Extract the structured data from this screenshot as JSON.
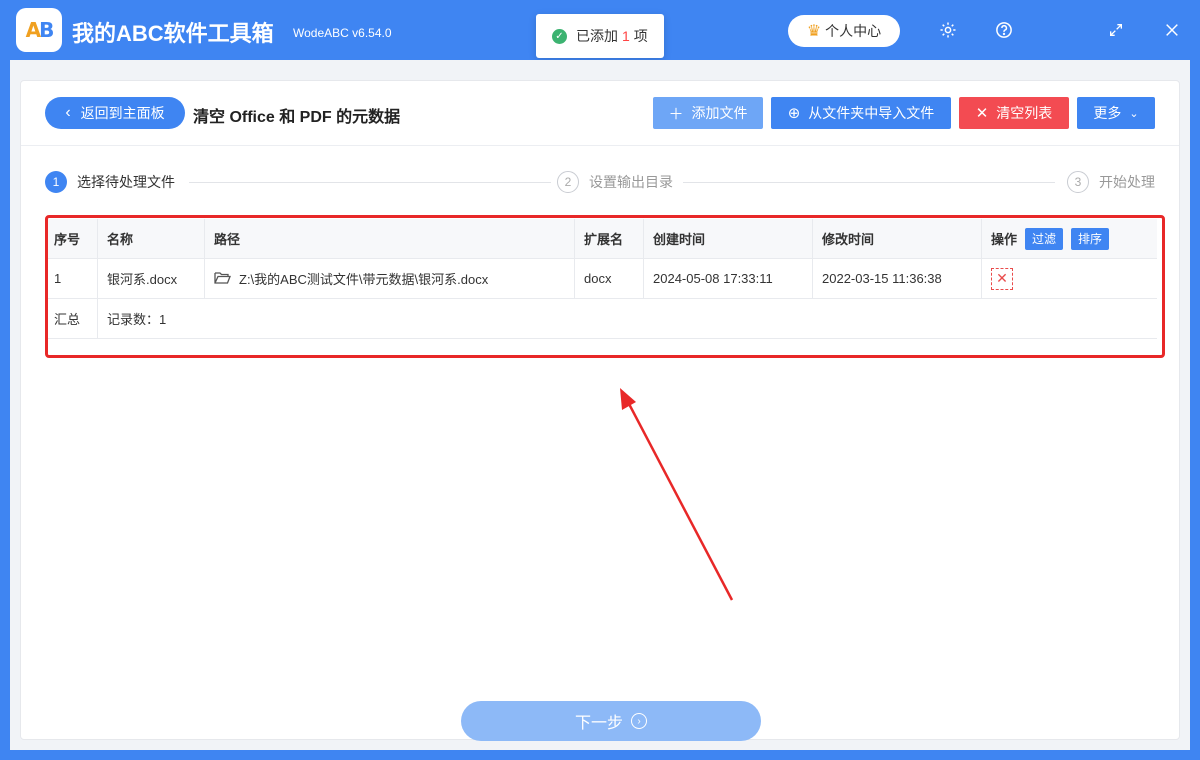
{
  "app": {
    "logo_letters": "AB",
    "title": "我的ABC软件工具箱",
    "version": "WodeABC v6.54.0",
    "user_center": "个人中心"
  },
  "toast": {
    "prefix": "已添加",
    "count": "1",
    "suffix": "项"
  },
  "toolbar": {
    "back_label": "返回到主面板",
    "page_title": "清空 Office 和 PDF 的元数据",
    "add_file": "添加文件",
    "import_folder": "从文件夹中导入文件",
    "clear_list": "清空列表",
    "more": "更多"
  },
  "steps": [
    {
      "num": "1",
      "label": "选择待处理文件",
      "active": true
    },
    {
      "num": "2",
      "label": "设置输出目录",
      "active": false
    },
    {
      "num": "3",
      "label": "开始处理",
      "active": false
    }
  ],
  "table": {
    "headers": {
      "index": "序号",
      "name": "名称",
      "path": "路径",
      "ext": "扩展名",
      "created": "创建时间",
      "modified": "修改时间",
      "actions": "操作",
      "filter": "过滤",
      "sort": "排序"
    },
    "rows": [
      {
        "index": "1",
        "name": "银河系.docx",
        "path": "Z:\\我的ABC测试文件\\带元数据\\银河系.docx",
        "ext": "docx",
        "created": "2024-05-08 17:33:11",
        "modified": "2022-03-15 11:36:38"
      }
    ],
    "summary": {
      "label": "汇总",
      "records": "记录数：1"
    }
  },
  "next": {
    "label": "下一步"
  },
  "colors": {
    "accent": "#3f85f2",
    "danger": "#f34b52",
    "annotation": "#e82828"
  }
}
